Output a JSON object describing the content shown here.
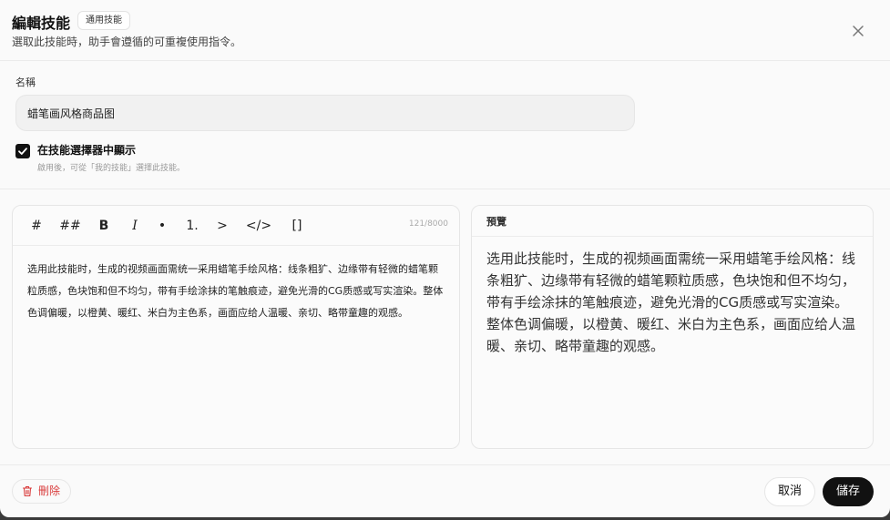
{
  "header": {
    "title": "編輯技能",
    "badge": "通用技能",
    "subtitle": "選取此技能時，助手會遵循的可重複使用指令。"
  },
  "form": {
    "name_label": "名稱",
    "name_value": "蜡笔画风格商品图",
    "show_in_picker_label": "在技能選擇器中顯示",
    "show_in_picker_hint": "啟用後，可從「我的技能」選擇此技能。",
    "show_in_picker_checked": true
  },
  "editor": {
    "toolbar": [
      "#",
      "##",
      "B",
      "I",
      "•",
      "1.",
      ">",
      "</>",
      "[]"
    ],
    "char_count": "121/8000",
    "content": "选用此技能时，生成的视频画面需统一采用蜡笔手绘风格：线条粗犷、边缘带有轻微的蜡笔颗粒质感，色块饱和但不均匀，带有手绘涂抹的笔触痕迹，避免光滑的CG质感或写实渲染。整体色调偏暖，以橙黄、暖红、米白为主色系，画面应给人温暖、亲切、略带童趣的观感。"
  },
  "preview": {
    "title": "預覽",
    "content": "选用此技能时，生成的视频画面需统一采用蜡笔手绘风格：线条粗犷、边缘带有轻微的蜡笔颗粒质感，色块饱和但不均匀，带有手绘涂抹的笔触痕迹，避免光滑的CG质感或写实渲染。整体色调偏暖，以橙黄、暖红、米白为主色系，画面应给人温暖、亲切、略带童趣的观感。"
  },
  "footer": {
    "delete_label": "刪除",
    "cancel_label": "取消",
    "save_label": "儲存"
  },
  "icons": {
    "close": "close-icon",
    "check": "check-icon",
    "trash": "trash-icon"
  },
  "colors": {
    "danger": "#d93a3a",
    "primary": "#111111"
  }
}
